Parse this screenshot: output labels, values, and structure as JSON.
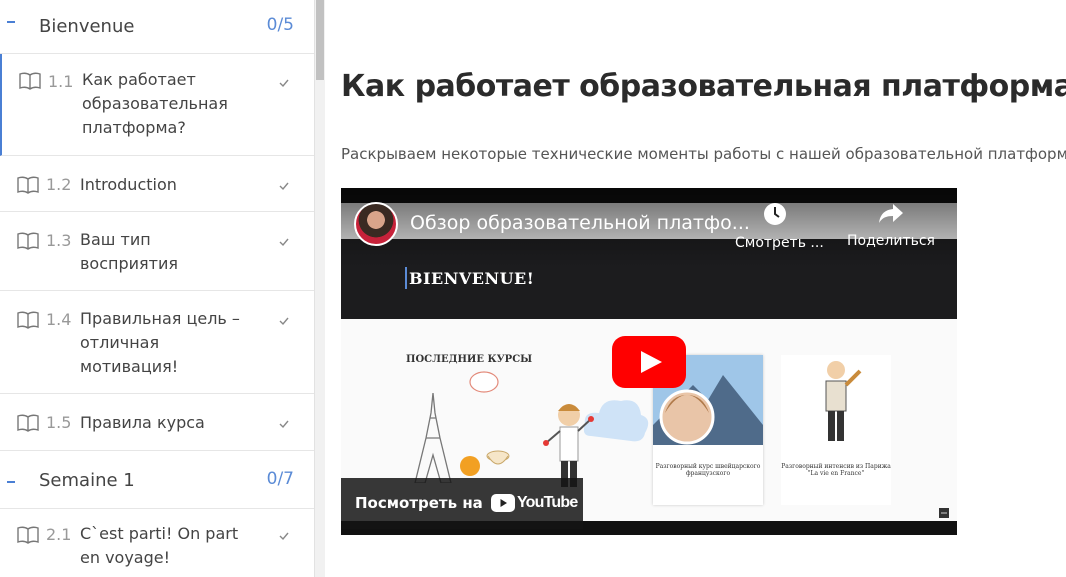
{
  "sidebar": {
    "sections": [
      {
        "title": "Bienvenue",
        "count": "0/5",
        "lessons": [
          {
            "num": "1.1",
            "title": "Как работает образовательная платформа?"
          },
          {
            "num": "1.2",
            "title": "Introduction"
          },
          {
            "num": "1.3",
            "title": "Ваш тип восприятия"
          },
          {
            "num": "1.4",
            "title": "Правильная цель – отличная мотивация!"
          },
          {
            "num": "1.5",
            "title": "Правила курса"
          }
        ]
      },
      {
        "title": "Semaine 1",
        "count": "0/7",
        "lessons": [
          {
            "num": "2.1",
            "title": "C`est parti! On part en voyage!"
          }
        ]
      }
    ]
  },
  "main": {
    "title": "Как работает образовательная платформа?",
    "description": "Раскрываем некоторые технические моменты работы с нашей образовательной платформой."
  },
  "video": {
    "title": "Обзор образовательной платфо...",
    "watch_later_label": "Смотреть ...",
    "share_label": "Поделиться",
    "watch_on_label": "Посмотреть на",
    "youtube_label": "YouTube",
    "screen_heading": "BIENVENUE!",
    "screen_subheading": "ПОСЛЕДНИЕ КУРСЫ",
    "card1_text": "Разговорный курс швейцарского французского",
    "card2_text": "Разговорный интенсив из Парижа \"La vie en France\""
  },
  "colors": {
    "accent": "#4a7fd4",
    "youtube_red": "#ff0000"
  }
}
